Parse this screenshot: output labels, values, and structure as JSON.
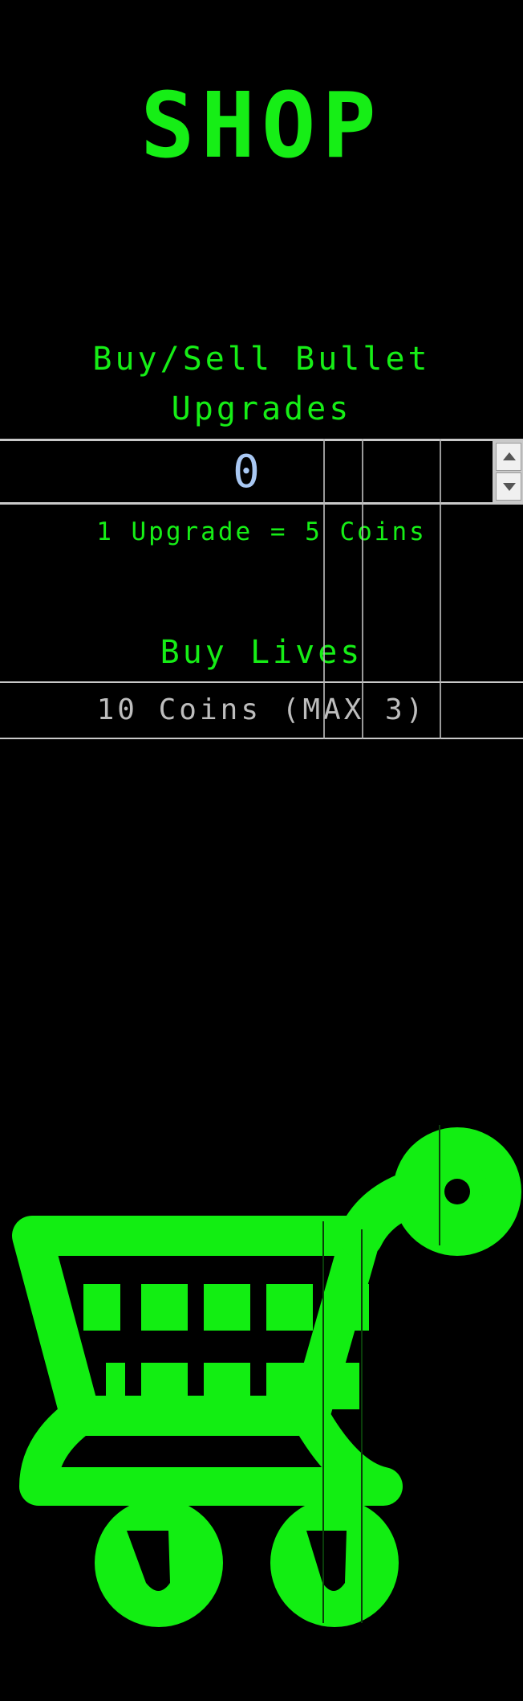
{
  "page": {
    "title": "SHOP",
    "accent_color": "#16ee16",
    "background_color": "#000000"
  },
  "upgrades": {
    "heading_line1": "Buy/Sell Bullet",
    "heading_line2": "Upgrades",
    "value": "0",
    "rate": "1 Upgrade = 5 Coins",
    "spin_up_icon": "triangle-up-icon",
    "spin_down_icon": "triangle-down-icon"
  },
  "lives": {
    "heading": "Buy Lives",
    "button_label": "10 Coins (MAX 3)"
  },
  "decor": {
    "icon": "shopping-cart-icon"
  }
}
